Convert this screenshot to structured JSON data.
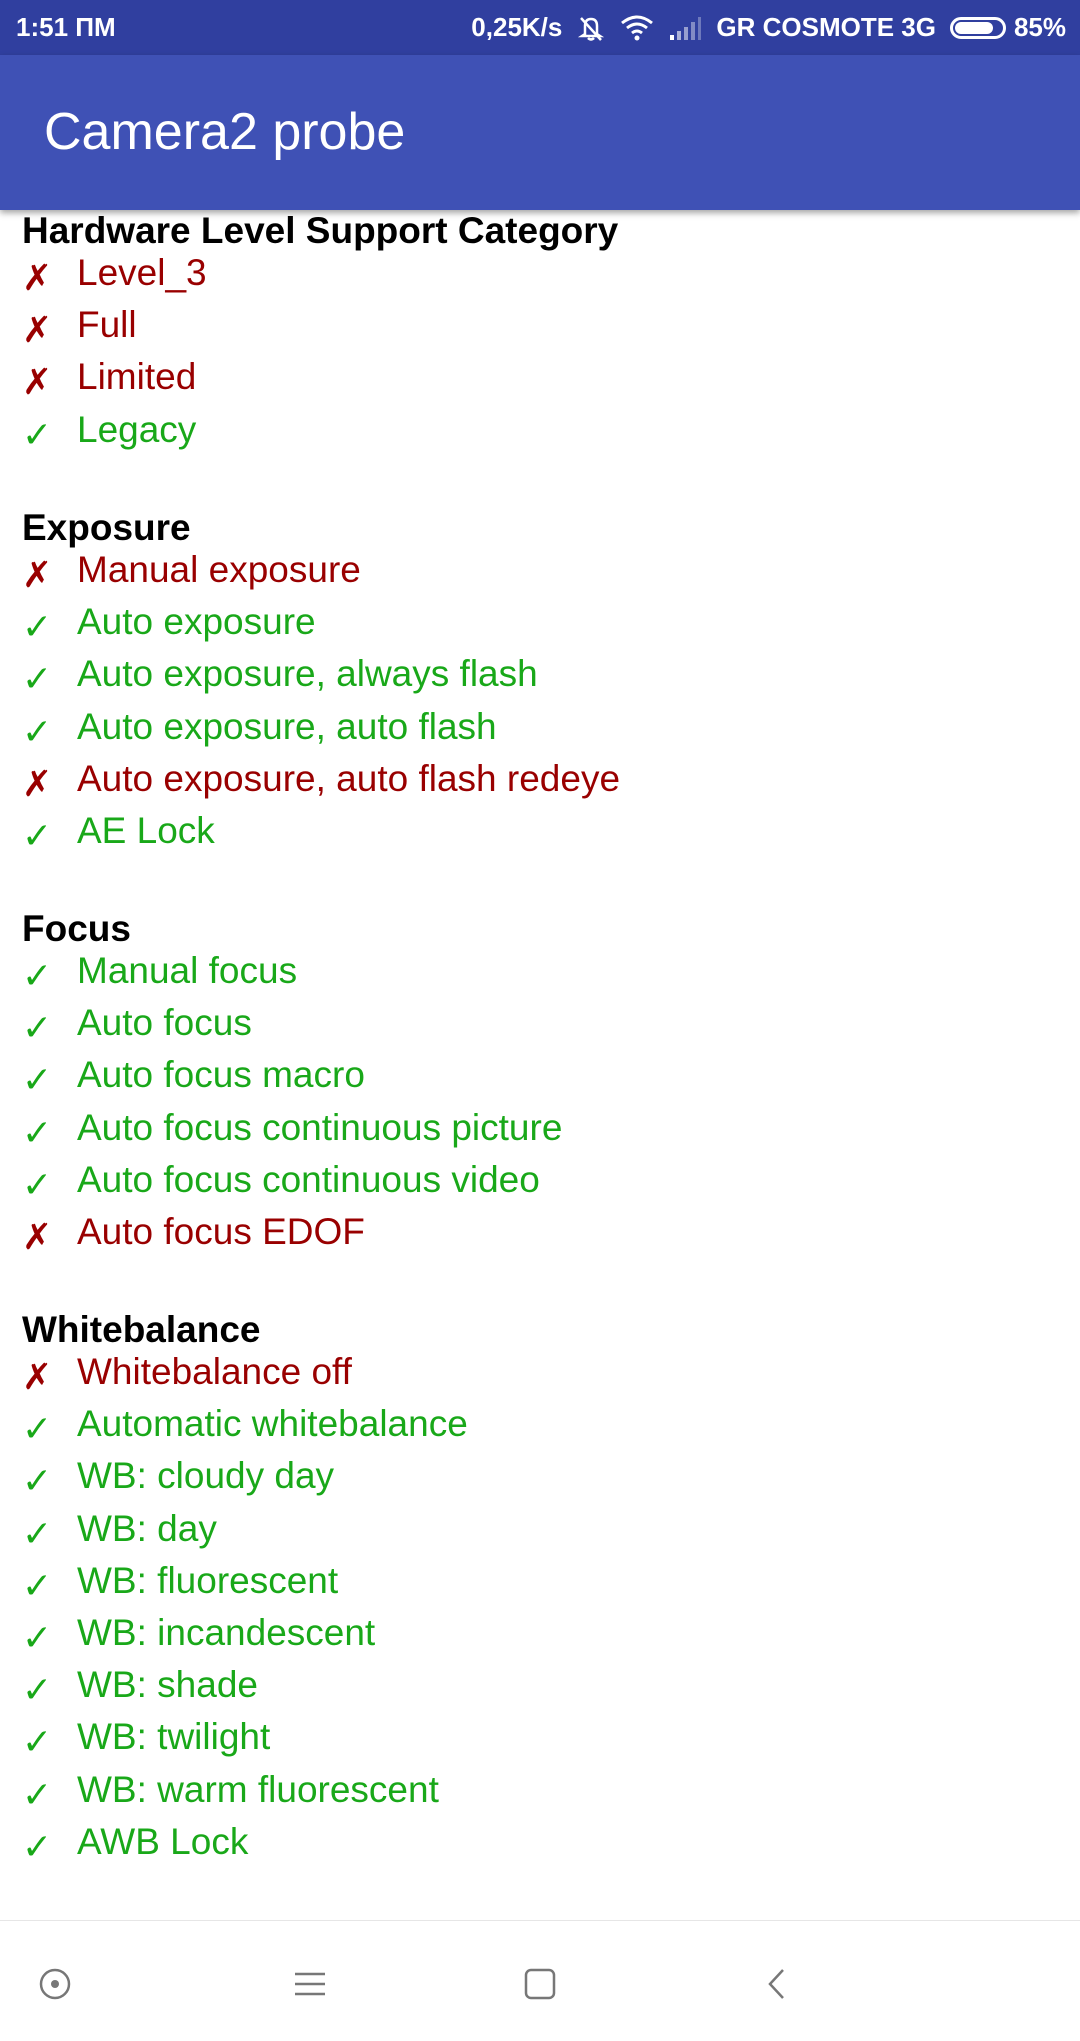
{
  "status_bar": {
    "time": "1:51 ΠΜ",
    "network_speed": "0,25K/s",
    "carrier": "GR COSMOTE 3G",
    "battery": "85%",
    "battery_level": 0.85,
    "icons": [
      "muted-bell-icon",
      "wifi-icon",
      "signal-icon",
      "battery-icon"
    ]
  },
  "app_bar": {
    "title": "Camera2 probe"
  },
  "colors": {
    "supported": "#19a819",
    "unsupported": "#990000",
    "app_bar": "#3f51b5",
    "status_bar": "#303f9f"
  },
  "marks": {
    "supported": "✓",
    "unsupported": "✗"
  },
  "sections": [
    {
      "title": "Hardware Level Support Category",
      "items": [
        {
          "label": "Level_3",
          "supported": false
        },
        {
          "label": "Full",
          "supported": false
        },
        {
          "label": "Limited",
          "supported": false
        },
        {
          "label": "Legacy",
          "supported": true
        }
      ]
    },
    {
      "title": "Exposure",
      "items": [
        {
          "label": "Manual exposure",
          "supported": false
        },
        {
          "label": "Auto exposure",
          "supported": true
        },
        {
          "label": "Auto exposure, always flash",
          "supported": true
        },
        {
          "label": "Auto exposure, auto flash",
          "supported": true
        },
        {
          "label": "Auto exposure, auto flash redeye",
          "supported": false
        },
        {
          "label": "AE Lock",
          "supported": true
        }
      ]
    },
    {
      "title": "Focus",
      "items": [
        {
          "label": "Manual focus",
          "supported": true
        },
        {
          "label": "Auto focus",
          "supported": true
        },
        {
          "label": "Auto focus macro",
          "supported": true
        },
        {
          "label": "Auto focus continuous picture",
          "supported": true
        },
        {
          "label": "Auto focus continuous video",
          "supported": true
        },
        {
          "label": "Auto focus EDOF",
          "supported": false
        }
      ]
    },
    {
      "title": "Whitebalance",
      "items": [
        {
          "label": "Whitebalance off",
          "supported": false
        },
        {
          "label": "Automatic whitebalance",
          "supported": true
        },
        {
          "label": "WB: cloudy day",
          "supported": true
        },
        {
          "label": "WB: day",
          "supported": true
        },
        {
          "label": "WB: fluorescent",
          "supported": true
        },
        {
          "label": "WB: incandescent",
          "supported": true
        },
        {
          "label": "WB: shade",
          "supported": true
        },
        {
          "label": "WB: twilight",
          "supported": true
        },
        {
          "label": "WB: warm fluorescent",
          "supported": true
        },
        {
          "label": "AWB Lock",
          "supported": true
        }
      ]
    }
  ],
  "nav_bar": {
    "buttons": [
      "assistant-button",
      "menu-button",
      "home-button",
      "back-button"
    ]
  }
}
